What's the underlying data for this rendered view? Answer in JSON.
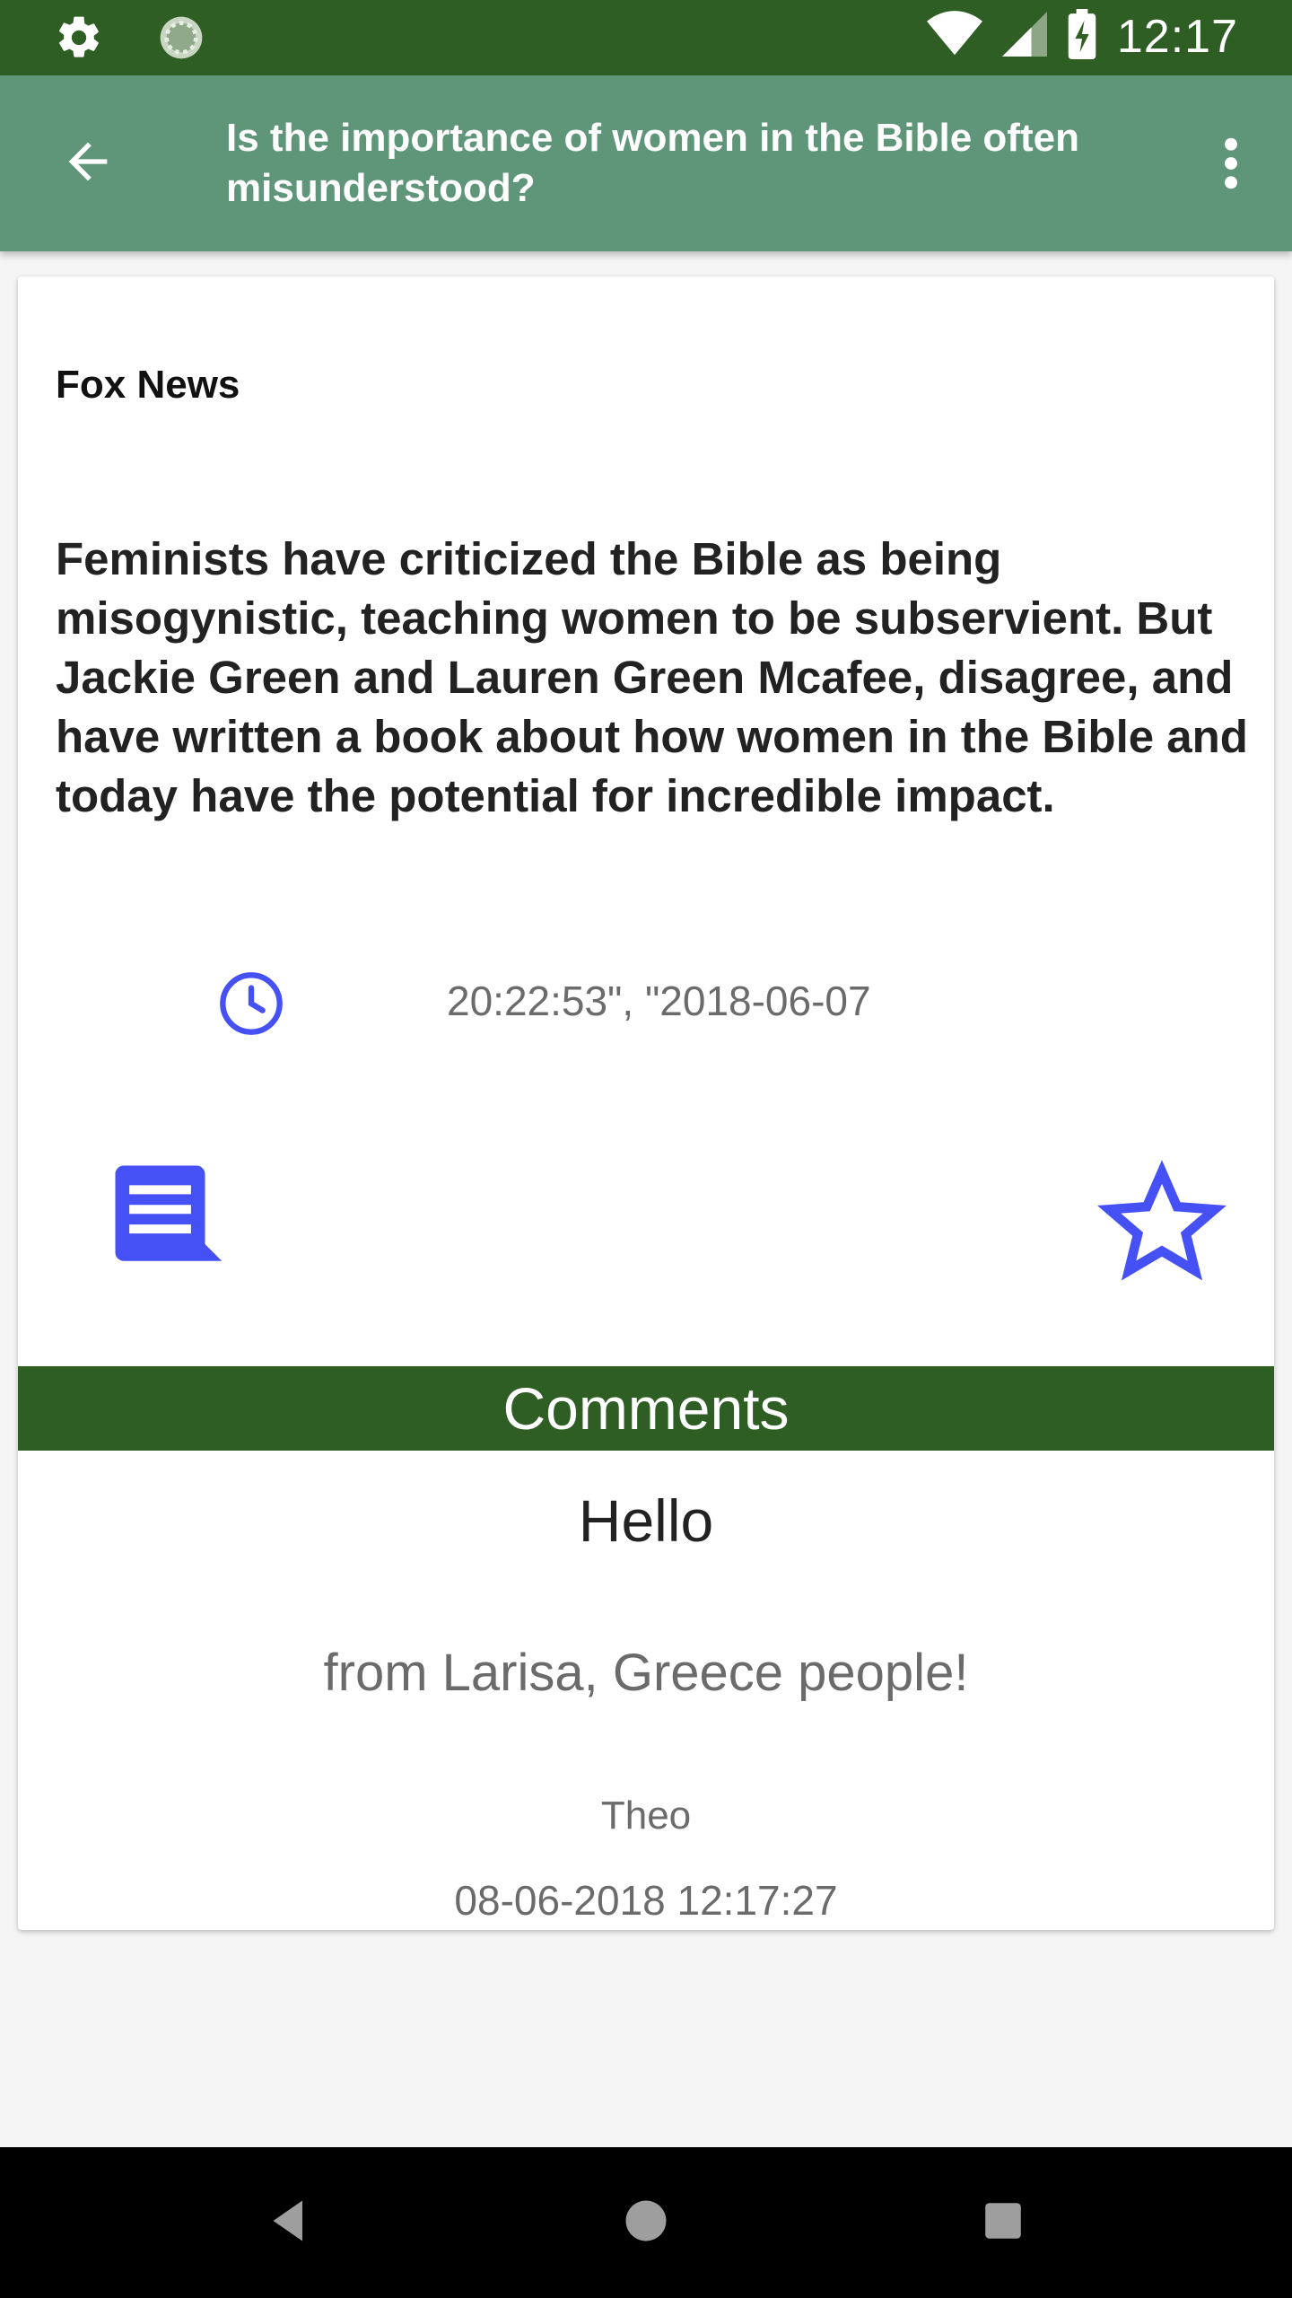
{
  "status_bar": {
    "time": "12:17",
    "icons": [
      "gear-icon",
      "sync-icon",
      "wifi-icon",
      "cell-signal-icon",
      "battery-charging-icon"
    ]
  },
  "app_bar": {
    "title": "Is the importance of women in the Bible often misunderstood?",
    "back_icon": "arrow-back-icon",
    "more_icon": "more-vert-icon"
  },
  "article": {
    "source": "Fox News",
    "summary": "Feminists have criticized the Bible as being misogynistic, teaching women to be subservient. But Jackie Green and Lauren Green Mcafee, disagree, and have written a book about how women in the Bible and today have the potential for incredible impact.",
    "timestamp": "20:22:53\", \"2018-06-07",
    "clock_icon": "clock-icon",
    "comment_icon": "comment-icon",
    "favorite_icon": "star-outline-icon",
    "accent_color": "#4651f5"
  },
  "comments": {
    "header": "Comments",
    "items": [
      {
        "title": "Hello",
        "body": "from Larisa, Greece people!",
        "author": "Theo",
        "date": "08-06-2018 12:17:27"
      }
    ]
  },
  "nav_bar": {
    "icons": [
      "back-triangle-icon",
      "home-circle-icon",
      "recents-square-icon"
    ]
  },
  "colors": {
    "status_bar": "#2f5e24",
    "app_bar": "#5f967a",
    "comments_header": "#2f5e24"
  }
}
